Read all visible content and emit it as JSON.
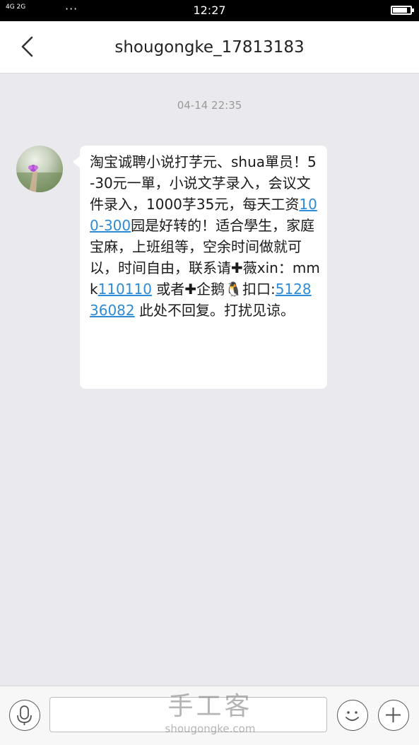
{
  "status_bar": {
    "network_labels": "4G 2G",
    "time": "12:27",
    "battery_level": 0.85
  },
  "header": {
    "title": "shougongke_17813183"
  },
  "conversation": {
    "timestamp": "04-14 22:35",
    "message": {
      "part1": "淘宝诚聘小说打芓元、shua單员！5-30元一單，小说文芓录入，会议文件录入，1000芓35元，每天工资",
      "link1": "100-300",
      "part2": "园是好转的！适合學生，家庭宝麻，上班组等，空余时间做就可以，时间自由，联系请",
      "plus1": "✚",
      "part3": "薇xin：mmk",
      "link2": "110110",
      "part4": " 或者",
      "plus2": "✚",
      "part5": "企鹅",
      "penguin": "🐧",
      "part6": "扣口:",
      "link3": "512836082",
      "part7": " 此处不回复。打扰见谅。"
    }
  },
  "watermark": {
    "logo": "手工客",
    "url": "shougongke.com"
  },
  "icons": {
    "back": "chevron-left-icon",
    "voice": "microphone-icon",
    "emoji": "smiley-icon",
    "add": "plus-icon"
  }
}
